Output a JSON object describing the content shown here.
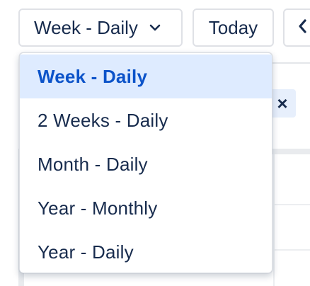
{
  "toolbar": {
    "view_select": {
      "value": "Week - Daily",
      "icon": "chevron-down-icon"
    },
    "today_label": "Today",
    "prev_icon": "chevron-left-icon"
  },
  "background": {
    "chip_icon": "close-icon",
    "chip_glyph": "×"
  },
  "dropdown": {
    "options": [
      {
        "label": "Week - Daily",
        "selected": true
      },
      {
        "label": "2 Weeks - Daily",
        "selected": false
      },
      {
        "label": "Month - Daily",
        "selected": false
      },
      {
        "label": "Year - Monthly",
        "selected": false
      },
      {
        "label": "Year - Daily",
        "selected": false
      }
    ]
  },
  "colors": {
    "selected_bg": "#deebff",
    "selected_text": "#0c53c9",
    "text": "#172b4d",
    "border": "#dfe1e6"
  }
}
